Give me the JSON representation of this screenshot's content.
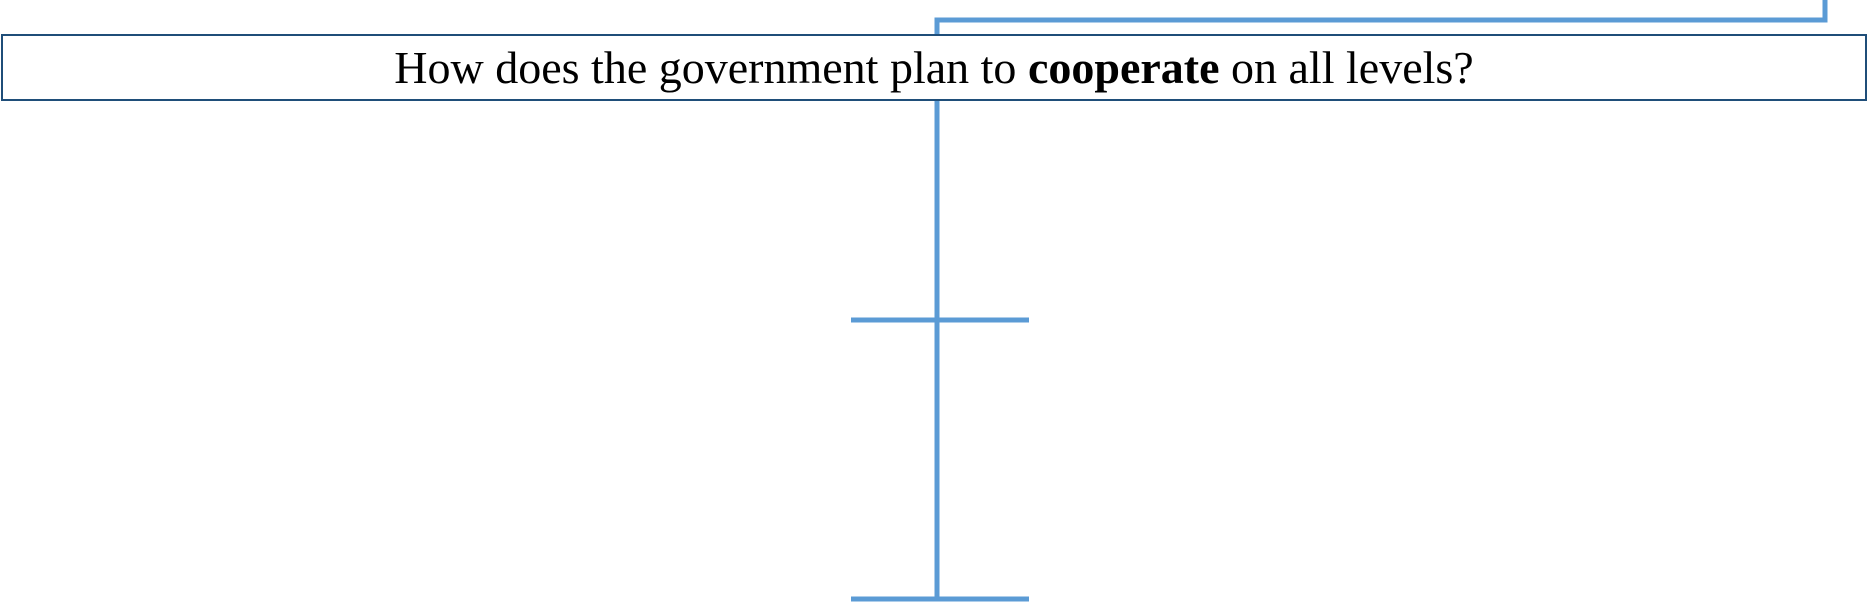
{
  "question": {
    "before": "How does the government plan to ",
    "emphasis": "cooperate",
    "after": " on all levels?"
  },
  "colors": {
    "connector": "#5b9bd5",
    "box_border": "#1f4e79",
    "text": "#000000"
  }
}
